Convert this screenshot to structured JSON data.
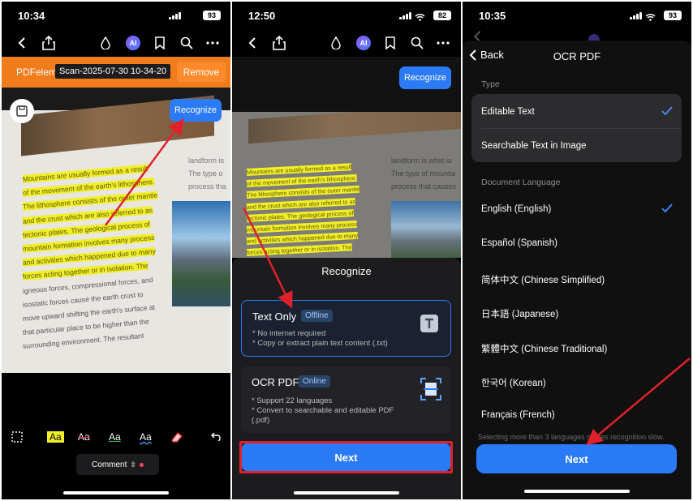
{
  "screens": [
    {
      "status": {
        "time": "10:34",
        "battery": "93"
      },
      "scan_bar": {
        "brand": "PDFelem",
        "filename": "Scan-2025-07-30 10-34-20",
        "remove_label": "Remove"
      },
      "recognize_label": "Recognize",
      "doc_lines": [
        "Mountains are usually formed as a result",
        "of the movement of the earth's lithosphere.",
        "The lithosphere consists of the outer mantle",
        "and the crust which are also referred to as",
        "tectonic plates. The geological process of",
        "mountain formation involves many process",
        "and activities which happened due to many",
        "forces acting together or in isolation. The",
        "igneous forces, compressional forces, and",
        "isostatic forces cause the earth crust to",
        "move upward shifting the earth's surface at",
        "that particular place to be higher than the",
        "surrounding environment. The resultant"
      ],
      "right_text": [
        "landform is",
        "The type o",
        "process tha"
      ],
      "bottom_tools": [
        "Aa",
        "Aa",
        "Aa",
        "Aa"
      ],
      "comment_label": "Comment"
    },
    {
      "status": {
        "time": "12:50",
        "battery": "82"
      },
      "recognize_label": "Recognize",
      "doc_lines": [
        "Mountains are usually formed as a result",
        "of the movement of the earth's lithosphere.",
        "The lithosphere consists of the outer mantle",
        "and the crust which are also referred to as",
        "tectonic plates. The geological process of",
        "mountain formation involves many process",
        "and activities which happened due to many",
        "forces acting together or in isolation. The",
        "igneous forces, compressional forces, and"
      ],
      "right_text": [
        "landform is what is",
        "The type of mountai",
        "process that causes"
      ],
      "sheet": {
        "title": "Recognize",
        "options": [
          {
            "title": "Text Only",
            "badge": "Offline",
            "desc": [
              "* No internet required",
              "* Copy or extract plain text content (.txt)"
            ]
          },
          {
            "title": "OCR PDF",
            "badge": "Online",
            "desc": [
              "* Support 22 languages",
              "* Convert to searchable and editable PDF",
              "(.pdf)"
            ]
          }
        ],
        "next_label": "Next"
      }
    },
    {
      "status": {
        "time": "10:35",
        "battery": "93"
      },
      "panel": {
        "back_label": "Back",
        "title": "OCR PDF",
        "type_label": "Type",
        "types": [
          "Editable Text",
          "Searchable Text in Image"
        ],
        "lang_label": "Document Language",
        "languages": [
          "English (English)",
          "Español (Spanish)",
          "简体中文 (Chinese Simplified)",
          "日本語 (Japanese)",
          "繁體中文 (Chinese Traditional)",
          "한국어 (Korean)",
          "Français (French)"
        ],
        "hint": "Selecting more than 3 languages makes recognition slow.",
        "next_label": "Next"
      }
    }
  ],
  "colors": {
    "accent": "#2b7bf6",
    "highlight": "#f2ef2a",
    "orange": "#f07c1c",
    "annotation_red": "#e0212b"
  }
}
